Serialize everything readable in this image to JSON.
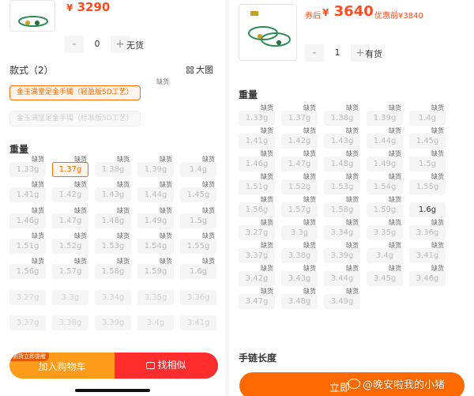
{
  "left": {
    "price_symbol": "¥",
    "price": "3290",
    "quantity": "0",
    "minus": "-",
    "plus": "+",
    "stock_status": "无货",
    "style_section": "款式（2）",
    "big_picture": "大图",
    "styles": [
      {
        "label": "金玉满堂足金手镯（轻盈版5D工艺）",
        "tag": "缺货",
        "state": "selected"
      },
      {
        "label": "金玉满堂足金手镯（标准版5D工艺）",
        "tag": "",
        "state": "disabled"
      }
    ],
    "weight_section": "重量",
    "weights": [
      {
        "w": "1.33g",
        "tag": "缺货",
        "state": "oos"
      },
      {
        "w": "1.37g",
        "tag": "缺货",
        "state": "selected"
      },
      {
        "w": "1.38g",
        "tag": "缺货",
        "state": "oos"
      },
      {
        "w": "1.39g",
        "tag": "缺货",
        "state": "oos"
      },
      {
        "w": "1.4g",
        "tag": "缺货",
        "state": "oos"
      },
      {
        "w": "1.41g",
        "tag": "缺货",
        "state": "oos"
      },
      {
        "w": "1.42g",
        "tag": "缺货",
        "state": "oos"
      },
      {
        "w": "1.43g",
        "tag": "缺货",
        "state": "oos"
      },
      {
        "w": "1.44g",
        "tag": "缺货",
        "state": "oos"
      },
      {
        "w": "1.45g",
        "tag": "缺货",
        "state": "oos"
      },
      {
        "w": "1.46g",
        "tag": "缺货",
        "state": "oos"
      },
      {
        "w": "1.47g",
        "tag": "缺货",
        "state": "oos"
      },
      {
        "w": "1.48g",
        "tag": "缺货",
        "state": "oos"
      },
      {
        "w": "1.49g",
        "tag": "缺货",
        "state": "oos"
      },
      {
        "w": "1.5g",
        "tag": "缺货",
        "state": "oos"
      },
      {
        "w": "1.51g",
        "tag": "缺货",
        "state": "oos"
      },
      {
        "w": "1.52g",
        "tag": "缺货",
        "state": "oos"
      },
      {
        "w": "1.53g",
        "tag": "缺货",
        "state": "oos"
      },
      {
        "w": "1.54g",
        "tag": "缺货",
        "state": "oos"
      },
      {
        "w": "1.55g",
        "tag": "缺货",
        "state": "oos"
      },
      {
        "w": "1.56g",
        "tag": "缺货",
        "state": "oos"
      },
      {
        "w": "1.57g",
        "tag": "缺货",
        "state": "oos"
      },
      {
        "w": "1.58g",
        "tag": "缺货",
        "state": "oos"
      },
      {
        "w": "1.59g",
        "tag": "缺货",
        "state": "oos"
      },
      {
        "w": "1.6g",
        "tag": "缺货",
        "state": "oos"
      },
      {
        "w": "3.27g",
        "tag": "",
        "state": "dim"
      },
      {
        "w": "3.3g",
        "tag": "",
        "state": "dim"
      },
      {
        "w": "3.34g",
        "tag": "",
        "state": "dim"
      },
      {
        "w": "3.35g",
        "tag": "",
        "state": "dim"
      },
      {
        "w": "3.36g",
        "tag": "",
        "state": "dim"
      },
      {
        "w": "3.37g",
        "tag": "",
        "state": "dim"
      },
      {
        "w": "3.38g",
        "tag": "",
        "state": "dim"
      },
      {
        "w": "3.39g",
        "tag": "",
        "state": "dim"
      },
      {
        "w": "3.4g",
        "tag": "",
        "state": "dim"
      },
      {
        "w": "3.41g",
        "tag": "",
        "state": "dim"
      }
    ],
    "cart_badge": "到货立即提醒",
    "add_to_cart": "加入购物车",
    "find_similar": "找相似",
    "colors": {
      "accent": "#ff6a00",
      "price": "#ff4d1f",
      "cart": "#ff9b1a",
      "similar": "#ff2d2d"
    }
  },
  "right": {
    "coupon_label": "券后",
    "price_symbol": "¥",
    "price": "3640",
    "original_price": "优惠前¥3840",
    "quantity": "1",
    "minus": "-",
    "plus": "+",
    "stock_status": "有货",
    "weight_section": "重量",
    "weights": [
      {
        "w": "1.33g",
        "tag": "缺货",
        "state": "oos"
      },
      {
        "w": "1.37g",
        "tag": "缺货",
        "state": "oos"
      },
      {
        "w": "1.38g",
        "tag": "缺货",
        "state": "oos"
      },
      {
        "w": "1.39g",
        "tag": "缺货",
        "state": "oos"
      },
      {
        "w": "1.4g",
        "tag": "缺货",
        "state": "oos"
      },
      {
        "w": "1.41g",
        "tag": "缺货",
        "state": "oos"
      },
      {
        "w": "1.42g",
        "tag": "缺货",
        "state": "oos"
      },
      {
        "w": "1.43g",
        "tag": "缺货",
        "state": "oos"
      },
      {
        "w": "1.44g",
        "tag": "缺货",
        "state": "oos"
      },
      {
        "w": "1.45g",
        "tag": "缺货",
        "state": "oos"
      },
      {
        "w": "1.46g",
        "tag": "缺货",
        "state": "oos"
      },
      {
        "w": "1.47g",
        "tag": "缺货",
        "state": "oos"
      },
      {
        "w": "1.48g",
        "tag": "缺货",
        "state": "oos"
      },
      {
        "w": "1.49g",
        "tag": "缺货",
        "state": "oos"
      },
      {
        "w": "1.5g",
        "tag": "缺货",
        "state": "oos"
      },
      {
        "w": "1.51g",
        "tag": "缺货",
        "state": "oos"
      },
      {
        "w": "1.52g",
        "tag": "缺货",
        "state": "oos"
      },
      {
        "w": "1.53g",
        "tag": "缺货",
        "state": "oos"
      },
      {
        "w": "1.54g",
        "tag": "缺货",
        "state": "oos"
      },
      {
        "w": "1.55g",
        "tag": "缺货",
        "state": "oos"
      },
      {
        "w": "1.56g",
        "tag": "缺货",
        "state": "oos"
      },
      {
        "w": "1.57g",
        "tag": "缺货",
        "state": "oos"
      },
      {
        "w": "1.58g",
        "tag": "缺货",
        "state": "oos"
      },
      {
        "w": "1.59g",
        "tag": "缺货",
        "state": "oos"
      },
      {
        "w": "1.6g",
        "tag": "",
        "state": "avail"
      },
      {
        "w": "3.27g",
        "tag": "缺货",
        "state": "oos"
      },
      {
        "w": "3.3g",
        "tag": "缺货",
        "state": "oos"
      },
      {
        "w": "3.34g",
        "tag": "缺货",
        "state": "oos"
      },
      {
        "w": "3.35g",
        "tag": "缺货",
        "state": "oos"
      },
      {
        "w": "3.36g",
        "tag": "缺货",
        "state": "oos"
      },
      {
        "w": "3.37g",
        "tag": "缺货",
        "state": "oos"
      },
      {
        "w": "3.38g",
        "tag": "缺货",
        "state": "oos"
      },
      {
        "w": "3.39g",
        "tag": "缺货",
        "state": "oos"
      },
      {
        "w": "3.4g",
        "tag": "缺货",
        "state": "oos"
      },
      {
        "w": "3.41g",
        "tag": "缺货",
        "state": "oos"
      },
      {
        "w": "3.42g",
        "tag": "缺货",
        "state": "oos"
      },
      {
        "w": "3.43g",
        "tag": "缺货",
        "state": "oos"
      },
      {
        "w": "3.44g",
        "tag": "缺货",
        "state": "oos"
      },
      {
        "w": "3.45g",
        "tag": "缺货",
        "state": "oos"
      },
      {
        "w": "3.46g",
        "tag": "缺货",
        "state": "oos"
      },
      {
        "w": "3.47g",
        "tag": "缺货",
        "state": "oos"
      },
      {
        "w": "3.48g",
        "tag": "缺货",
        "state": "oos"
      },
      {
        "w": "3.49g",
        "tag": "缺货",
        "state": "oos"
      }
    ],
    "wrist_length": "手链长度",
    "buy_now": "立即",
    "watermark": "@晚安啦我的小猪"
  }
}
